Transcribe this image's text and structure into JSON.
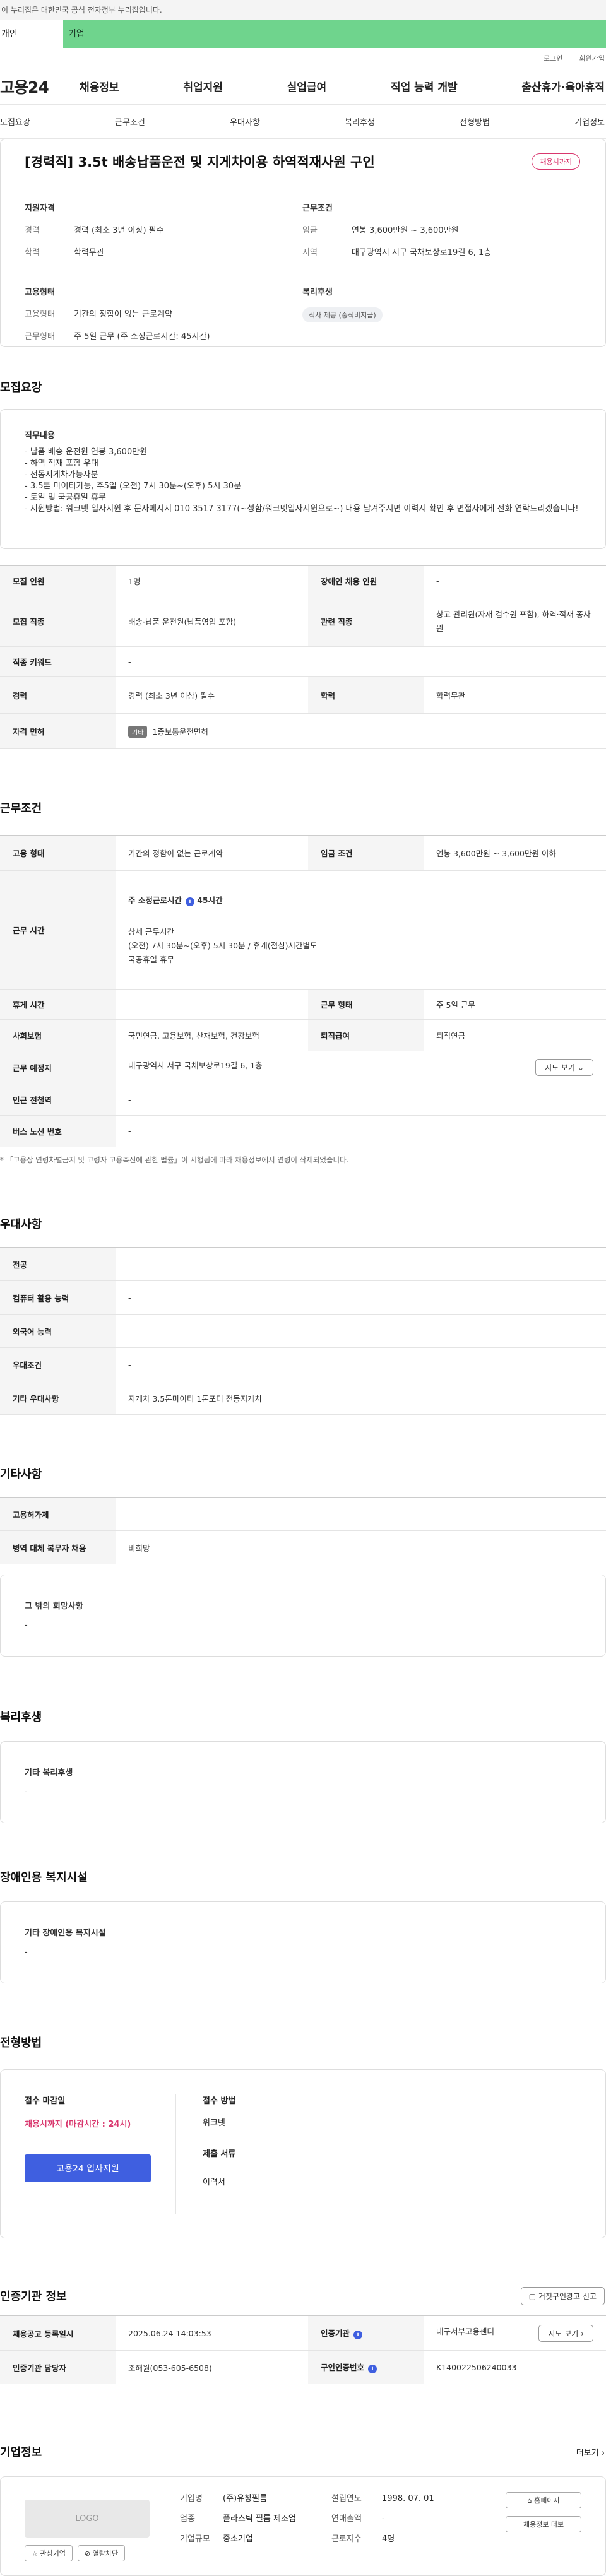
{
  "gov_banner": "이 누리집은 대한민국 공식 전자정부 누리집입니다.",
  "top_tabs": {
    "personal": "개인",
    "company": "기업"
  },
  "util": {
    "login": "로그인",
    "join": "회원가입"
  },
  "gnb": {
    "logo": "고용24",
    "menu": [
      "채용정보",
      "취업지원",
      "실업급여",
      "직업 능력 개발",
      "출산휴가·육아휴직"
    ]
  },
  "anchors": [
    "모집요강",
    "근무조건",
    "우대사항",
    "복리후생",
    "전형방법",
    "기업정보"
  ],
  "job": {
    "title": "[경력직] 3.5t 배송납품운전 및 지게차이용 하역적재사원 구인",
    "badge": "채용시까지"
  },
  "summary": {
    "qual": {
      "h": "지원자격",
      "k1": "경력",
      "v1": "경력 (최소 3년 이상) 필수",
      "k2": "학력",
      "v2": "학력무관"
    },
    "cond": {
      "h": "근무조건",
      "k1": "임금",
      "v1": "연봉 3,600만원 ~ 3,600만원",
      "k2": "지역",
      "v2": "대구광역시 서구 국채보상로19길 6, 1층"
    },
    "emp": {
      "h": "고용형태",
      "k1": "고용형태",
      "v1": "기간의 정함이 없는 근로계약",
      "k2": "근무형태",
      "v2": "주 5일 근무 (주 소정근로시간: 45시간)"
    },
    "welfare": {
      "h": "복리후생",
      "chip": "식사 제공 (중식비지급)"
    }
  },
  "recruit": {
    "heading": "모집요강",
    "duty_h": "직무내용",
    "duty_body": "- 납품 배송 운전원 연봉 3,600만원\n- 하역 적재 포함 우대\n- 전동지게차가능자분\n- 3.5톤 마이티가능, 주5일 (오전) 7시 30분~(오후) 5시 30분\n- 토일 및 국공휴일 휴무\n- 지원방법: 워크넷 입사지원 후 문자메시지 010 3517 3177(~성함/워크넷입사지원으로~) 내용 남겨주시면 이력서 확인 후 면접자에게 전화 연락드리겠습니다!",
    "rows": {
      "r1k1": "모집 인원",
      "r1v1": "1명",
      "r1k2": "장애인 채용 인원",
      "r1v2": "-",
      "r2k1": "모집 직종",
      "r2v1": "배송·납품 운전원(납품영업 포함)",
      "r2k2": "관련 직종",
      "r2v2": "창고 관리원(자재 검수원 포함), 하역·적재 종사원",
      "r3k1": "직종 키워드",
      "r3v1": "-",
      "r4k1": "경력",
      "r4v1": "경력 (최소 3년 이상) 필수",
      "r4k2": "학력",
      "r4v2": "학력무관",
      "r5k1": "자격 면허",
      "r5chip": "기타",
      "r5v1": "1종보통운전면허"
    }
  },
  "work": {
    "heading": "근무조건",
    "r1k1": "고용 형태",
    "r1v1": "기간의 정함이 없는 근로계약",
    "r1k2": "임금 조건",
    "r1v2": "연봉 3,600만원 ~ 3,600만원 이하",
    "r2k1": "근무 시간",
    "r2a": "주 소정근로시간",
    "r2a_val": "45시간",
    "r2b": "상세 근무시간",
    "r2c": "(오전) 7시 30분~(오후) 5시 30분 / 휴게(점심)시간별도",
    "r2d": "국공휴일 휴무",
    "r3k1": "휴게 시간",
    "r3v1": "-",
    "r3k2": "근무 형태",
    "r3v2": "주 5일 근무",
    "r4k1": "사회보험",
    "r4v1": "국민연금, 고용보험, 산재보험, 건강보험",
    "r4k2": "퇴직급여",
    "r4v2": "퇴직연금",
    "r5k1": "근무 예정지",
    "r5v1": "대구광역시 서구 국채보상로19길 6, 1층",
    "r5btn": "지도 보기",
    "r6k1": "인근 전철역",
    "r6v1": "-",
    "r7k1": "버스 노선 번호",
    "r7v1": "-",
    "note": "* 「고용상 연령차별금지 및 고령자 고용촉진에 관한 법률」이 시행됨에 따라 채용정보에서 연령이 삭제되었습니다."
  },
  "pref": {
    "heading": "우대사항",
    "r1k": "전공",
    "r1v": "-",
    "r2k": "컴퓨터 활용 능력",
    "r2v": "-",
    "r3k": "외국어 능력",
    "r3v": "-",
    "r4k": "우대조건",
    "r4v": "-",
    "r5k": "기타 우대사항",
    "r5v": "지게차 3.5톤마이티 1톤포터 전동지게차"
  },
  "etc": {
    "heading": "기타사항",
    "r1k": "고용허가제",
    "r1v": "-",
    "r2k": "병역 대체 복무자 채용",
    "r2v": "비희망",
    "wish_h": "그 밖의 희망사항",
    "wish_v": "-"
  },
  "benefit": {
    "heading": "복리후생",
    "h": "기타 복리후생",
    "v": "-"
  },
  "disabled": {
    "heading": "장애인용 복지시설",
    "h": "기타 장애인용 복지시설",
    "v": "-"
  },
  "selection": {
    "heading": "전형방법",
    "deadline_h": "접수 마감일",
    "deadline_v": "채용시까지 (마감시간 : 24시)",
    "method_h": "접수 방법",
    "method_v": "워크넷",
    "doc_h": "제출 서류",
    "doc_v": "이력서",
    "apply_btn": "고용24 입사지원"
  },
  "cert": {
    "heading": "인증기관 정보",
    "report_btn": "거짓구인광고 신고",
    "r1k1": "채용공고 등록일시",
    "r1v1": "2025.06.24 14:03:53",
    "r1k2": "인증기관",
    "r1v2": "대구서부고용센터",
    "r1btn": "지도 보기",
    "r2k1": "인증기관 담당자",
    "r2v1": "조해원(053-605-6508)",
    "r2k2": "구인인증번호",
    "r2v2": "K140022506240033"
  },
  "company": {
    "heading": "기업정보",
    "more": "더보기",
    "logo": "LOGO",
    "fav_btn": "관심기업",
    "block_btn": "열람차단",
    "k1": "기업명",
    "v1": "(주)유창필름",
    "k2": "업종",
    "v2": "플라스틱 필름 제조업",
    "k3": "기업규모",
    "v3": "중소기업",
    "k4": "설립연도",
    "v4": "1998. 07. 01",
    "k5": "연매출액",
    "v5": "-",
    "k6": "근로자수",
    "v6": "4명",
    "home_btn": "홈페이지",
    "jobs_btn": "채용정보 더보"
  },
  "colors": {
    "green": "#6fd48d",
    "pink": "#d9376e",
    "blue": "#3f5fe0"
  }
}
